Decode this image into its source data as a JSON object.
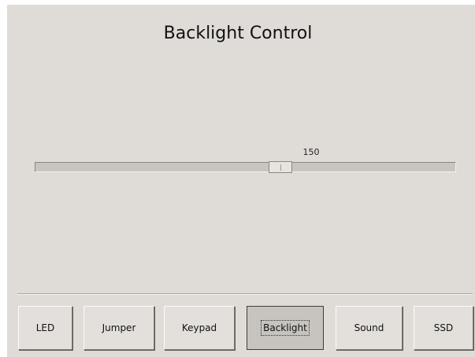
{
  "title": "Backlight Control",
  "slider": {
    "value": 150,
    "min": 0,
    "max": 255,
    "value_label": "150"
  },
  "nav": {
    "buttons": [
      {
        "label": "LED",
        "active": false
      },
      {
        "label": "Jumper",
        "active": false
      },
      {
        "label": "Keypad",
        "active": false
      },
      {
        "label": "Backlight",
        "active": true
      },
      {
        "label": "Sound",
        "active": false
      },
      {
        "label": "SSD",
        "active": false
      }
    ]
  },
  "colors": {
    "panel": "#dfdcd8",
    "active_button": "#c7c4bf"
  }
}
